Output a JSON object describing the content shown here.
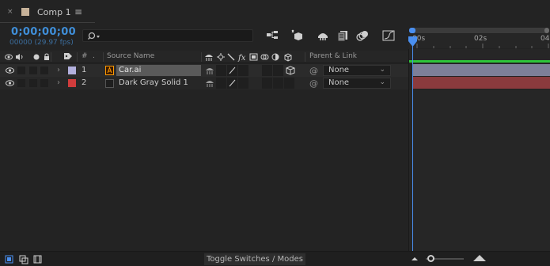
{
  "tab": {
    "title": "Comp 1",
    "close_glyph": "×",
    "menu_glyph": "≡",
    "color": "#c7b299"
  },
  "time": {
    "timecode": "0;00;00;00",
    "frames_fps": "00000 (29.97 fps)"
  },
  "search": {
    "value": "",
    "placeholder": ""
  },
  "toolbar_icons": [
    "comp-flowchart-icon",
    "draft-3d-icon",
    "shy-layers-icon",
    "frame-blending-icon",
    "motion-blur-icon",
    "graph-editor-icon"
  ],
  "ruler": {
    "ticks": [
      "00s",
      "02s",
      "04"
    ]
  },
  "columns": {
    "number": "#",
    "source_name": "Source Name",
    "parent_link": "Parent & Link"
  },
  "layers": [
    {
      "index": "1",
      "name": "Car.ai",
      "label_color": "#b2b0dd",
      "parent": "None",
      "bar_color": "#7d7f98"
    },
    {
      "index": "2",
      "name": "Dark Gray Solid 1",
      "label_color": "#d03c3c",
      "parent": "None",
      "bar_color": "#8a3a3d"
    }
  ],
  "bottom": {
    "toggle_label": "Toggle Switches / Modes"
  },
  "colors": {
    "accent": "#4a8ff0",
    "work_area": "#2dc63a"
  }
}
